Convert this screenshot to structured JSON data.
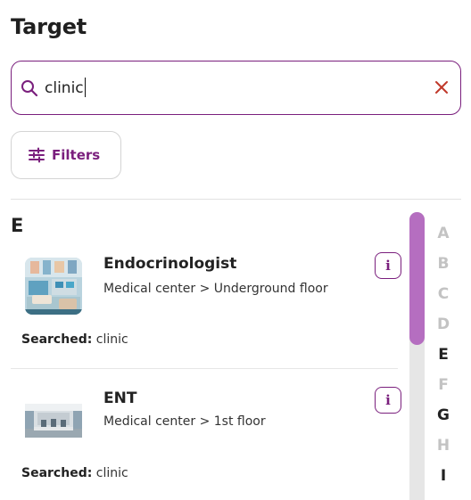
{
  "page": {
    "title": "Target"
  },
  "search": {
    "value": "clinic",
    "search_icon": "search-icon",
    "clear_icon": "close-icon"
  },
  "filters": {
    "label": "Filters",
    "icon": "sliders-icon"
  },
  "colors": {
    "accent": "#7a1f7d",
    "scroll_thumb": "#b56ec0"
  },
  "results": {
    "section_letter": "E",
    "searched_label": "Searched:",
    "items": [
      {
        "name": "Endocrinologist",
        "path": "Medical center > Underground floor",
        "searched": "clinic",
        "info": "i"
      },
      {
        "name": "ENT",
        "path": "Medical center > 1st floor",
        "searched": "clinic",
        "info": "i"
      }
    ]
  },
  "alphabet": [
    {
      "letter": "A",
      "active": false
    },
    {
      "letter": "B",
      "active": false
    },
    {
      "letter": "C",
      "active": false
    },
    {
      "letter": "D",
      "active": false
    },
    {
      "letter": "E",
      "active": true
    },
    {
      "letter": "F",
      "active": false
    },
    {
      "letter": "G",
      "active": true
    },
    {
      "letter": "H",
      "active": false
    },
    {
      "letter": "I",
      "active": true
    }
  ]
}
